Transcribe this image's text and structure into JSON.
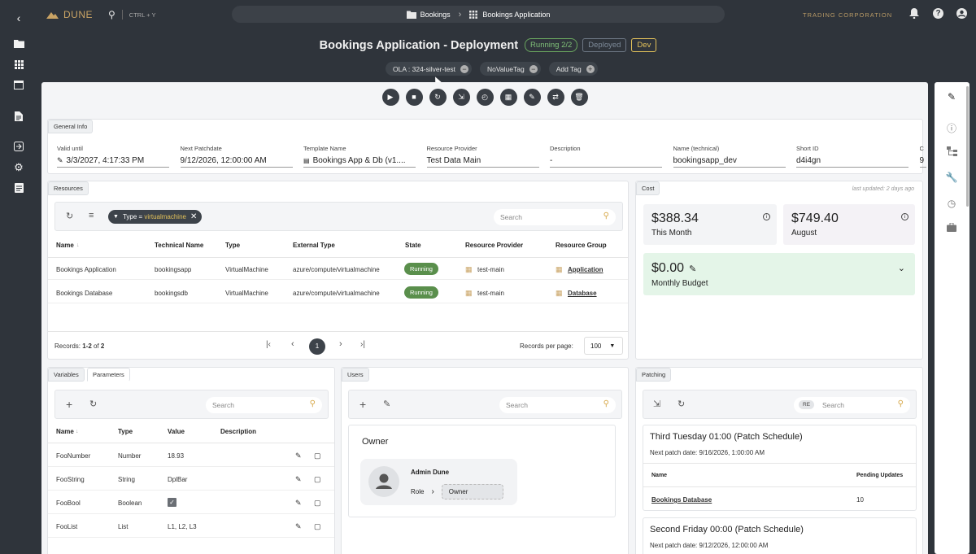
{
  "brand": {
    "name": "DUNE"
  },
  "search": {
    "shortcut": "CTRL + Y"
  },
  "breadcrumb": {
    "items": [
      "Bookings",
      "Bookings Application"
    ]
  },
  "org": {
    "name": "TRADING CORPORATION"
  },
  "header": {
    "title": "Bookings Application - Deployment",
    "badges": {
      "running": "Running 2/2",
      "deployed": "Deployed",
      "env": "Dev"
    }
  },
  "tags": {
    "items": [
      "OLA : 324-silver-test",
      "NoValueTag"
    ],
    "add_label": "Add Tag"
  },
  "colors": {
    "running": "#5a8f4c",
    "budget_bg": "#e4f5e8",
    "accent": "#d7a84a",
    "badge_env": "#e2c15a"
  },
  "general": {
    "tab": "General Info",
    "fields": [
      {
        "label": "Valid until",
        "value": "3/3/2027, 4:17:33 PM",
        "icon": "pencil-icon"
      },
      {
        "label": "Next Patchdate",
        "value": "9/12/2026, 12:00:00 AM"
      },
      {
        "label": "Template Name",
        "value": "Bookings App & Db (v1....",
        "icon": "document-icon"
      },
      {
        "label": "Resource Provider",
        "value": "Test Data Main"
      },
      {
        "label": "Description",
        "value": "-"
      },
      {
        "label": "Name (technical)",
        "value": "bookingsapp_dev"
      },
      {
        "label": "Short ID",
        "value": "d4i4gn"
      },
      {
        "label": "C",
        "value": "9"
      }
    ]
  },
  "resources": {
    "tab": "Resources",
    "filter_chip": "Type = ",
    "filter_value": "virtualmachine",
    "search_placeholder": "Search",
    "columns": [
      "Name",
      "Technical Name",
      "Type",
      "External Type",
      "State",
      "Resource Provider",
      "Resource Group"
    ],
    "rows": [
      {
        "name": "Bookings Application",
        "tech": "bookingsapp",
        "type": "VirtualMachine",
        "ext": "azure/compute/virtualmachine",
        "state": "Running",
        "provider": "test-main",
        "group": "Application"
      },
      {
        "name": "Bookings Database",
        "tech": "bookingsdb",
        "type": "VirtualMachine",
        "ext": "azure/compute/virtualmachine",
        "state": "Running",
        "provider": "test-main",
        "group": "Database"
      }
    ],
    "records_prefix": "Records: ",
    "records_range": "1-2",
    "records_of": " of ",
    "records_total": "2",
    "page": "1",
    "per_page_label": "Records per page:",
    "per_page": "100"
  },
  "cost": {
    "tab": "Cost",
    "updated": "last updated: 2 days ago",
    "this_month_value": "$388.34",
    "this_month_label": "This Month",
    "prev_value": "$749.40",
    "prev_label": "August",
    "budget_value": "$0.00",
    "budget_label": "Monthly Budget"
  },
  "variables": {
    "tabs": [
      "Variables",
      "Parameters"
    ],
    "search_placeholder": "Search",
    "columns": [
      "Name",
      "Type",
      "Value",
      "Description"
    ],
    "rows": [
      {
        "name": "FooNumber",
        "type": "Number",
        "value": "18.93"
      },
      {
        "name": "FooString",
        "type": "String",
        "value": "DplBar"
      },
      {
        "name": "FooBool",
        "type": "Boolean",
        "value": ""
      },
      {
        "name": "FooList",
        "type": "List",
        "value": "L1, L2, L3"
      }
    ]
  },
  "users": {
    "tab": "Users",
    "search_placeholder": "Search",
    "group": "Owner",
    "user_name": "Admin Dune",
    "role_label": "Role",
    "role_value": "Owner"
  },
  "patching": {
    "tab": "Patching",
    "chip": "RE",
    "search_placeholder": "Search",
    "schedules": [
      {
        "title": "Third Tuesday 01:00 (Patch Schedule)",
        "next": "Next patch date: 9/16/2026, 1:00:00 AM",
        "col_name": "Name",
        "col_pending": "Pending Updates",
        "row_name": "Bookings Database",
        "row_pending": "10"
      },
      {
        "title": "Second Friday 00:00 (Patch Schedule)",
        "next": "Next patch date: 9/12/2026, 12:00:00 AM"
      }
    ]
  }
}
